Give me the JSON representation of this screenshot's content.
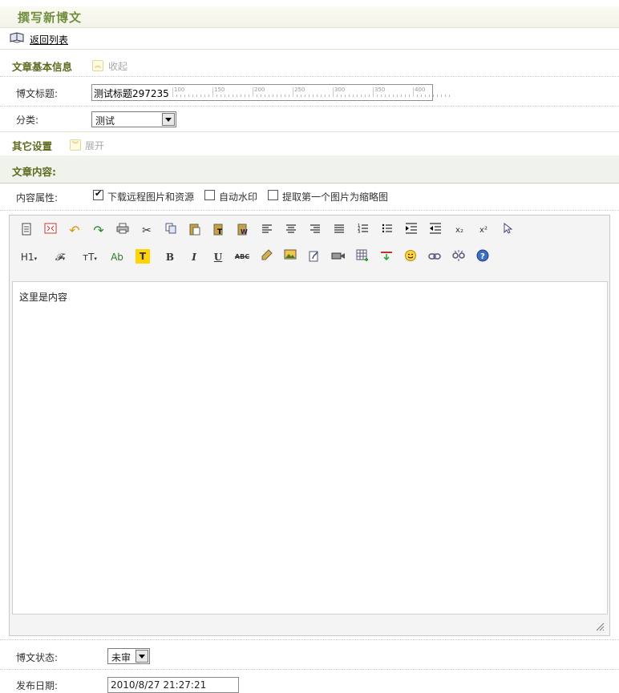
{
  "page_title": "撰写新博文",
  "back_link": "返回列表",
  "basic_section": {
    "title": "文章基本信息",
    "toggle_label": "收起"
  },
  "title_field": {
    "label": "博文标题:",
    "value": "测试标题297235",
    "ruler_ticks": [
      "100",
      "150",
      "200",
      "250",
      "300",
      "350",
      "400"
    ]
  },
  "category": {
    "label": "分类:",
    "value": "测试"
  },
  "other_section": {
    "title": "其它设置",
    "toggle_label": "展开"
  },
  "content_section": {
    "title": "文章内容:"
  },
  "content_props": {
    "label": "内容属性:",
    "options": [
      {
        "label": "下载远程图片和资源",
        "checked": true
      },
      {
        "label": "自动水印",
        "checked": false
      },
      {
        "label": "提取第一个图片为缩略图",
        "checked": false
      }
    ]
  },
  "toolbar": {
    "row1_icons": [
      "source-icon",
      "fullscreen-icon",
      "undo-icon",
      "redo-icon",
      "print-icon",
      "cut-icon",
      "copy-icon",
      "paste-icon",
      "paste-text-icon",
      "paste-word-icon",
      "align-left-icon",
      "align-center-icon",
      "align-right-icon",
      "align-justify-icon",
      "ordered-list-icon",
      "unordered-list-icon",
      "indent-icon",
      "outdent-icon",
      "subscript-icon",
      "superscript-icon",
      "select-all-icon"
    ],
    "row2_icons": [
      "heading-icon",
      "font-family-icon",
      "font-size-icon",
      "text-color-icon",
      "highlight-icon",
      "bold-icon",
      "italic-icon",
      "underline-icon",
      "strikethrough-icon",
      "clear-format-icon",
      "image-icon",
      "flash-icon",
      "media-icon",
      "table-icon",
      "horizontal-rule-icon",
      "emoticon-icon",
      "link-icon",
      "unlink-icon",
      "help-icon"
    ],
    "heading_label": "H1",
    "font_family_label": "𝓕",
    "font_size_label": "ᴛT",
    "text_color_label": "Ab",
    "highlight_label": "T",
    "bold_label": "B",
    "italic_label": "I",
    "underline_label": "U",
    "strike_label": "ABC",
    "subscript_label": "x₂",
    "superscript_label": "x²"
  },
  "editor_content": "这里是内容",
  "status": {
    "label": "博文状态:",
    "value": "未审"
  },
  "publish_date": {
    "label": "发布日期:",
    "value": "2010/8/27 21:27:21"
  },
  "colors": {
    "title_green": "#6f8f3e",
    "section_olive": "#5d6b1e",
    "content_bar": "#f0f3ec"
  }
}
